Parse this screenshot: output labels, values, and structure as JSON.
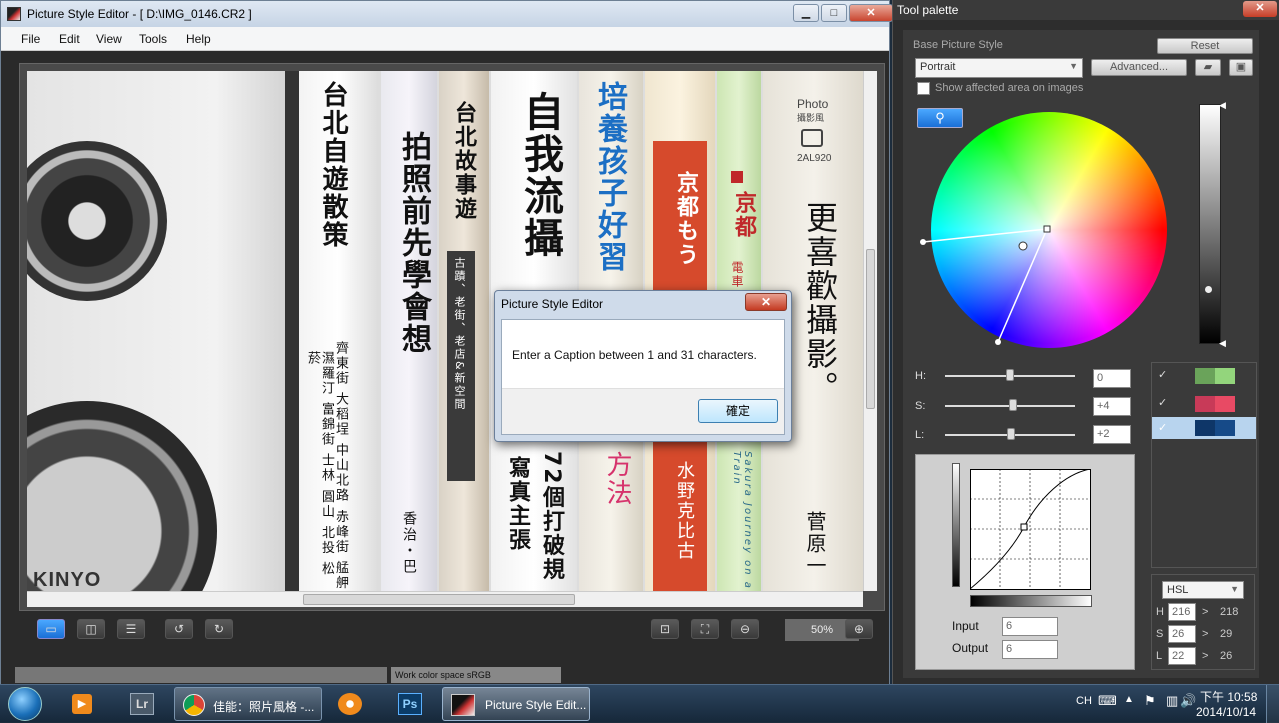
{
  "main_window": {
    "title": "Picture Style Editor - [ D:\\IMG_0146.CR2 ]",
    "controls": {
      "minimize": "▁",
      "maximize": "□",
      "close": "✕"
    }
  },
  "menu": [
    "File",
    "Edit",
    "View",
    "Tools",
    "Help"
  ],
  "photo": {
    "brand": "KINYO",
    "book_texts": [
      "台北自遊散策",
      "拍照前先學會想",
      "台北故事遊",
      "古蹟、老街、老店&新空間",
      "自我流攝",
      "72個打破規",
      "寫真主張",
      "培養孩子好習",
      "方法",
      "京都もう",
      "水野克比古",
      "京都",
      "電車",
      "Sakura Journey on a Train",
      "Photo",
      "攝影風",
      "2AL920",
      "更喜歡攝影。",
      "菅原一",
      "濕羅汀 富錦街 士林 圓山 北投 松菸",
      "齊東街 大稻埕 中山北路 赤峰街 艋舺",
      "香治・巴"
    ]
  },
  "toolbar": {
    "zoom": "50%",
    "buttons": [
      "single-view",
      "split-view-vertical",
      "split-view-horizontal",
      "rotate-left",
      "rotate-right",
      "fit-window",
      "actual-size",
      "zoom-out",
      "zoom-in"
    ]
  },
  "status": {
    "color_space": "Work color space  sRGB"
  },
  "dialog": {
    "title": "Picture Style Editor",
    "message": "Enter a Caption between 1 and 31 characters.",
    "ok": "確定",
    "close": "✕"
  },
  "palette": {
    "title": "Tool palette",
    "close": "✕",
    "base_style_label": "Base Picture Style",
    "reset": "Reset",
    "base_style": "Portrait",
    "advanced": "Advanced...",
    "show_affected": "Show affected area on images",
    "h_label": "H:",
    "s_label": "S:",
    "l_label": "L:",
    "h_value": "0",
    "s_value": "+4",
    "l_value": "+2",
    "color_entries": [
      {
        "checked": "✓",
        "color": "#7fbf6a"
      },
      {
        "checked": "✓",
        "color": "#e04660"
      },
      {
        "checked": "✓",
        "color": "#13407a"
      }
    ],
    "input_label": "Input",
    "output_label": "Output",
    "input_value": "6",
    "output_value": "6",
    "space_mode": "HSL",
    "hsl_rows": [
      {
        "label": "H",
        "from": "216",
        "arrow": ">",
        "to": "218"
      },
      {
        "label": "S",
        "from": "26",
        "arrow": ">",
        "to": "29"
      },
      {
        "label": "L",
        "from": "22",
        "arrow": ">",
        "to": "26"
      }
    ]
  },
  "taskbar": {
    "items": [
      {
        "label": "",
        "icon": "start-orb"
      },
      {
        "label": "",
        "icon": "media-player"
      },
      {
        "label": "Lr",
        "icon": "lightroom"
      },
      {
        "label": "佳能：照片風格 -...",
        "icon": "chrome"
      },
      {
        "label": "",
        "icon": "vlc-like"
      },
      {
        "label": "Ps",
        "icon": "photoshop"
      },
      {
        "label": "Picture Style Edit...",
        "icon": "picture-style-editor"
      }
    ],
    "lang": "CH",
    "time": "下午 10:58",
    "date": "2014/10/14"
  },
  "colors": {
    "accent": "#1a6fd6",
    "taskbar": "#1c2c3c"
  }
}
